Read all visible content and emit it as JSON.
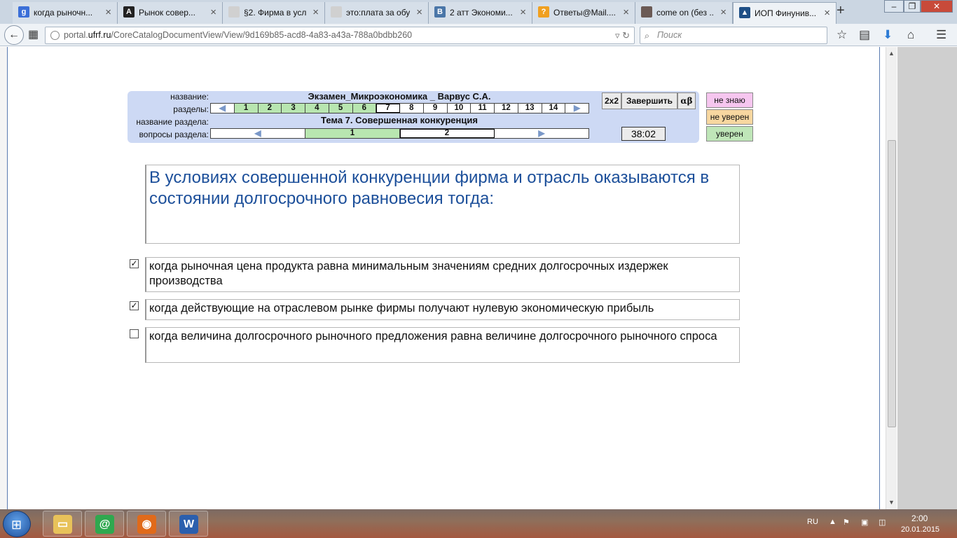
{
  "browser": {
    "tabs": [
      {
        "title": "когда рыночн...",
        "icon": "google-icon",
        "color": "#3b6fd8",
        "glyph": "g"
      },
      {
        "title": "Рынок совер...",
        "icon": "a-letter-icon",
        "color": "#222222",
        "glyph": "A"
      },
      {
        "title": "§2. Фирма в усл...",
        "icon": "blank-page-icon",
        "color": "#d0d0d0",
        "glyph": ""
      },
      {
        "title": "это:плата за обуч...",
        "icon": "blank-page-icon",
        "color": "#d0d0d0",
        "glyph": ""
      },
      {
        "title": "2 атт Экономи...",
        "icon": "vk-icon",
        "color": "#4a76a8",
        "glyph": "B"
      },
      {
        "title": "Ответы@Mail....",
        "icon": "question-icon",
        "color": "#f0a020",
        "glyph": "?"
      },
      {
        "title": "come on (без ...",
        "icon": "photo-icon",
        "color": "#6b5a55",
        "glyph": ""
      },
      {
        "title": "ИОП Финунив...",
        "icon": "graduation-cap-icon",
        "color": "#1e4f86",
        "glyph": "▲"
      }
    ],
    "url_prefix": "portal.",
    "url_domain": "ufrf.ru",
    "url_path": "/CoreCatalogDocumentView/View/9d169b85-acd8-4a83-a43a-788a0bdbb260",
    "search_placeholder": "Поиск"
  },
  "exam": {
    "labels": {
      "name": "название:",
      "sections": "разделы:",
      "section_name": "название раздела:",
      "section_questions": "вопросы раздела:"
    },
    "title": "Экзамен_Микроэкономика _ Варвус С.А.",
    "sections": [
      "1",
      "2",
      "3",
      "4",
      "5",
      "6",
      "7",
      "8",
      "9",
      "10",
      "11",
      "12",
      "13",
      "14"
    ],
    "sections_done_count": 6,
    "current_section": "7",
    "section_title": "Тема 7. Совершенная конкуренция",
    "questions": [
      "1",
      "2"
    ],
    "current_question": "2",
    "buttons": {
      "grid": "2x2",
      "finish": "Завершить",
      "alpha_beta": "αβ"
    },
    "timer": "38:02",
    "confidence": [
      {
        "label": "не знаю",
        "color": "#f6c6ef"
      },
      {
        "label": "не уверен",
        "color": "#f7d7a0"
      },
      {
        "label": "уверен",
        "color": "#bfe6b8"
      }
    ]
  },
  "question": {
    "text": "В условиях совершенной конкуренции фирма и отрасль оказываются в состоянии долгосрочного равновесия тогда:",
    "answers": [
      {
        "text": "когда рыночная цена продукта равна минимальным значениям средних долгосрочных издержек производства",
        "checked": true
      },
      {
        "text": "когда действующие на отраслевом рынке фирмы получают нулевую экономическую прибыль",
        "checked": true
      },
      {
        "text": "когда величина долгосрочного рыночного предложения равна величине долгосрочного рыночного спроса",
        "checked": false
      }
    ]
  },
  "taskbar": {
    "apps": [
      {
        "name": "explorer",
        "icon": "folder-icon",
        "color": "#e8c25a"
      },
      {
        "name": "mail-agent",
        "icon": "mail-at-icon",
        "color": "#2fa84f"
      },
      {
        "name": "firefox",
        "icon": "firefox-icon",
        "color": "#e06a1a"
      },
      {
        "name": "word",
        "icon": "word-icon",
        "color": "#2b5fad"
      }
    ],
    "lang": "RU",
    "time": "2:00",
    "date": "20.01.2015"
  }
}
